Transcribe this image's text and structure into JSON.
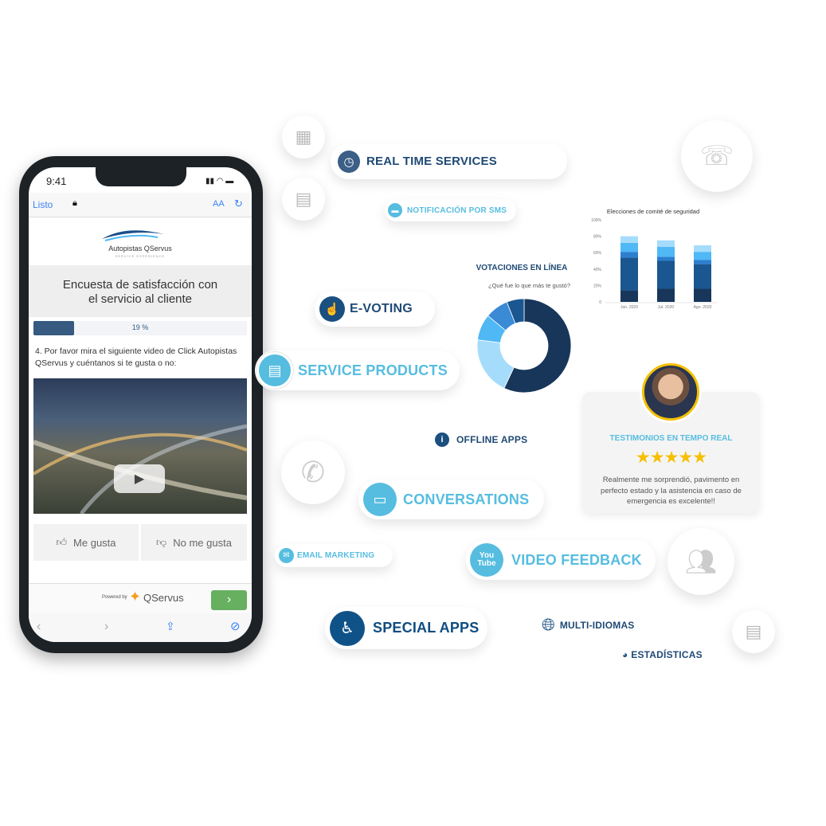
{
  "phone": {
    "time": "9:41",
    "browser": {
      "done": "Listo",
      "text_size": "AA"
    },
    "logo_name": "Autopistas QServus",
    "logo_tagline": "SERVICE EXPERIENCE",
    "survey_title_1": "Encuesta de satisfacción con",
    "survey_title_2": "el servicio al cliente",
    "progress_label": "19 %",
    "progress": 0.19,
    "question": "4. Por favor mira el siguiente video de Click Autopistas QServus y cuéntanos si te gusta o no:",
    "like": "Me gusta",
    "dislike": "No me gusta",
    "powered_by": "Powered by",
    "brand": "QServus",
    "next": "›"
  },
  "features": {
    "real_time": "REAL TIME SERVICES",
    "sms": "NOTIFICACIÓN POR SMS",
    "evoting": "E-VOTING",
    "service_products": "SERVICE PRODUCTS",
    "offline": "OFFLINE APPS",
    "conversations": "CONVERSATIONS",
    "email": "EMAIL MARKETING",
    "video": "VIDEO FEEDBACK",
    "special": "SPECIAL APPS",
    "multi": "MULTI-IDIOMAS",
    "stats": "ESTADÍSTICAS"
  },
  "testimonial": {
    "title": "TESTIMONIOS EN TEMPO REAL",
    "stars": 5,
    "text": "Realmente me sorprendió, pavimento en perfecto estado y la asistencia en caso de emergencia es excelente!!"
  },
  "colors": {
    "dark": "#1f4a75",
    "light": "#56bde0",
    "star": "#f5c000"
  },
  "chart_data": [
    {
      "type": "bar",
      "stacked": true,
      "title": "Elecciones de comité de seguridad",
      "categories": [
        "Jun. 2020",
        "Jul. 2020",
        "Ago. 2020"
      ],
      "yticks": [
        "0",
        "20%",
        "40%",
        "60%",
        "80%",
        "100%"
      ],
      "ylim": [
        0,
        100
      ],
      "series": [
        {
          "values": [
            14,
            16,
            16
          ],
          "color": "#17365a"
        },
        {
          "values": [
            40,
            34,
            30
          ],
          "color": "#1a5690"
        },
        {
          "values": [
            7,
            5,
            5
          ],
          "color": "#2c7fcf"
        },
        {
          "values": [
            11,
            12,
            10
          ],
          "color": "#4fb8f5"
        },
        {
          "values": [
            8,
            8,
            8
          ],
          "color": "#a6dcfb"
        }
      ]
    },
    {
      "type": "pie",
      "donut": true,
      "title": "VOTACIONES EN LÍNEA",
      "subtitle": "¿Qué fue lo que más te gustó?",
      "values": [
        57,
        20,
        9,
        8,
        6
      ],
      "colors": [
        "#17365a",
        "#a6dcfb",
        "#4fb8f5",
        "#3a8ad6",
        "#1a5690"
      ]
    }
  ]
}
